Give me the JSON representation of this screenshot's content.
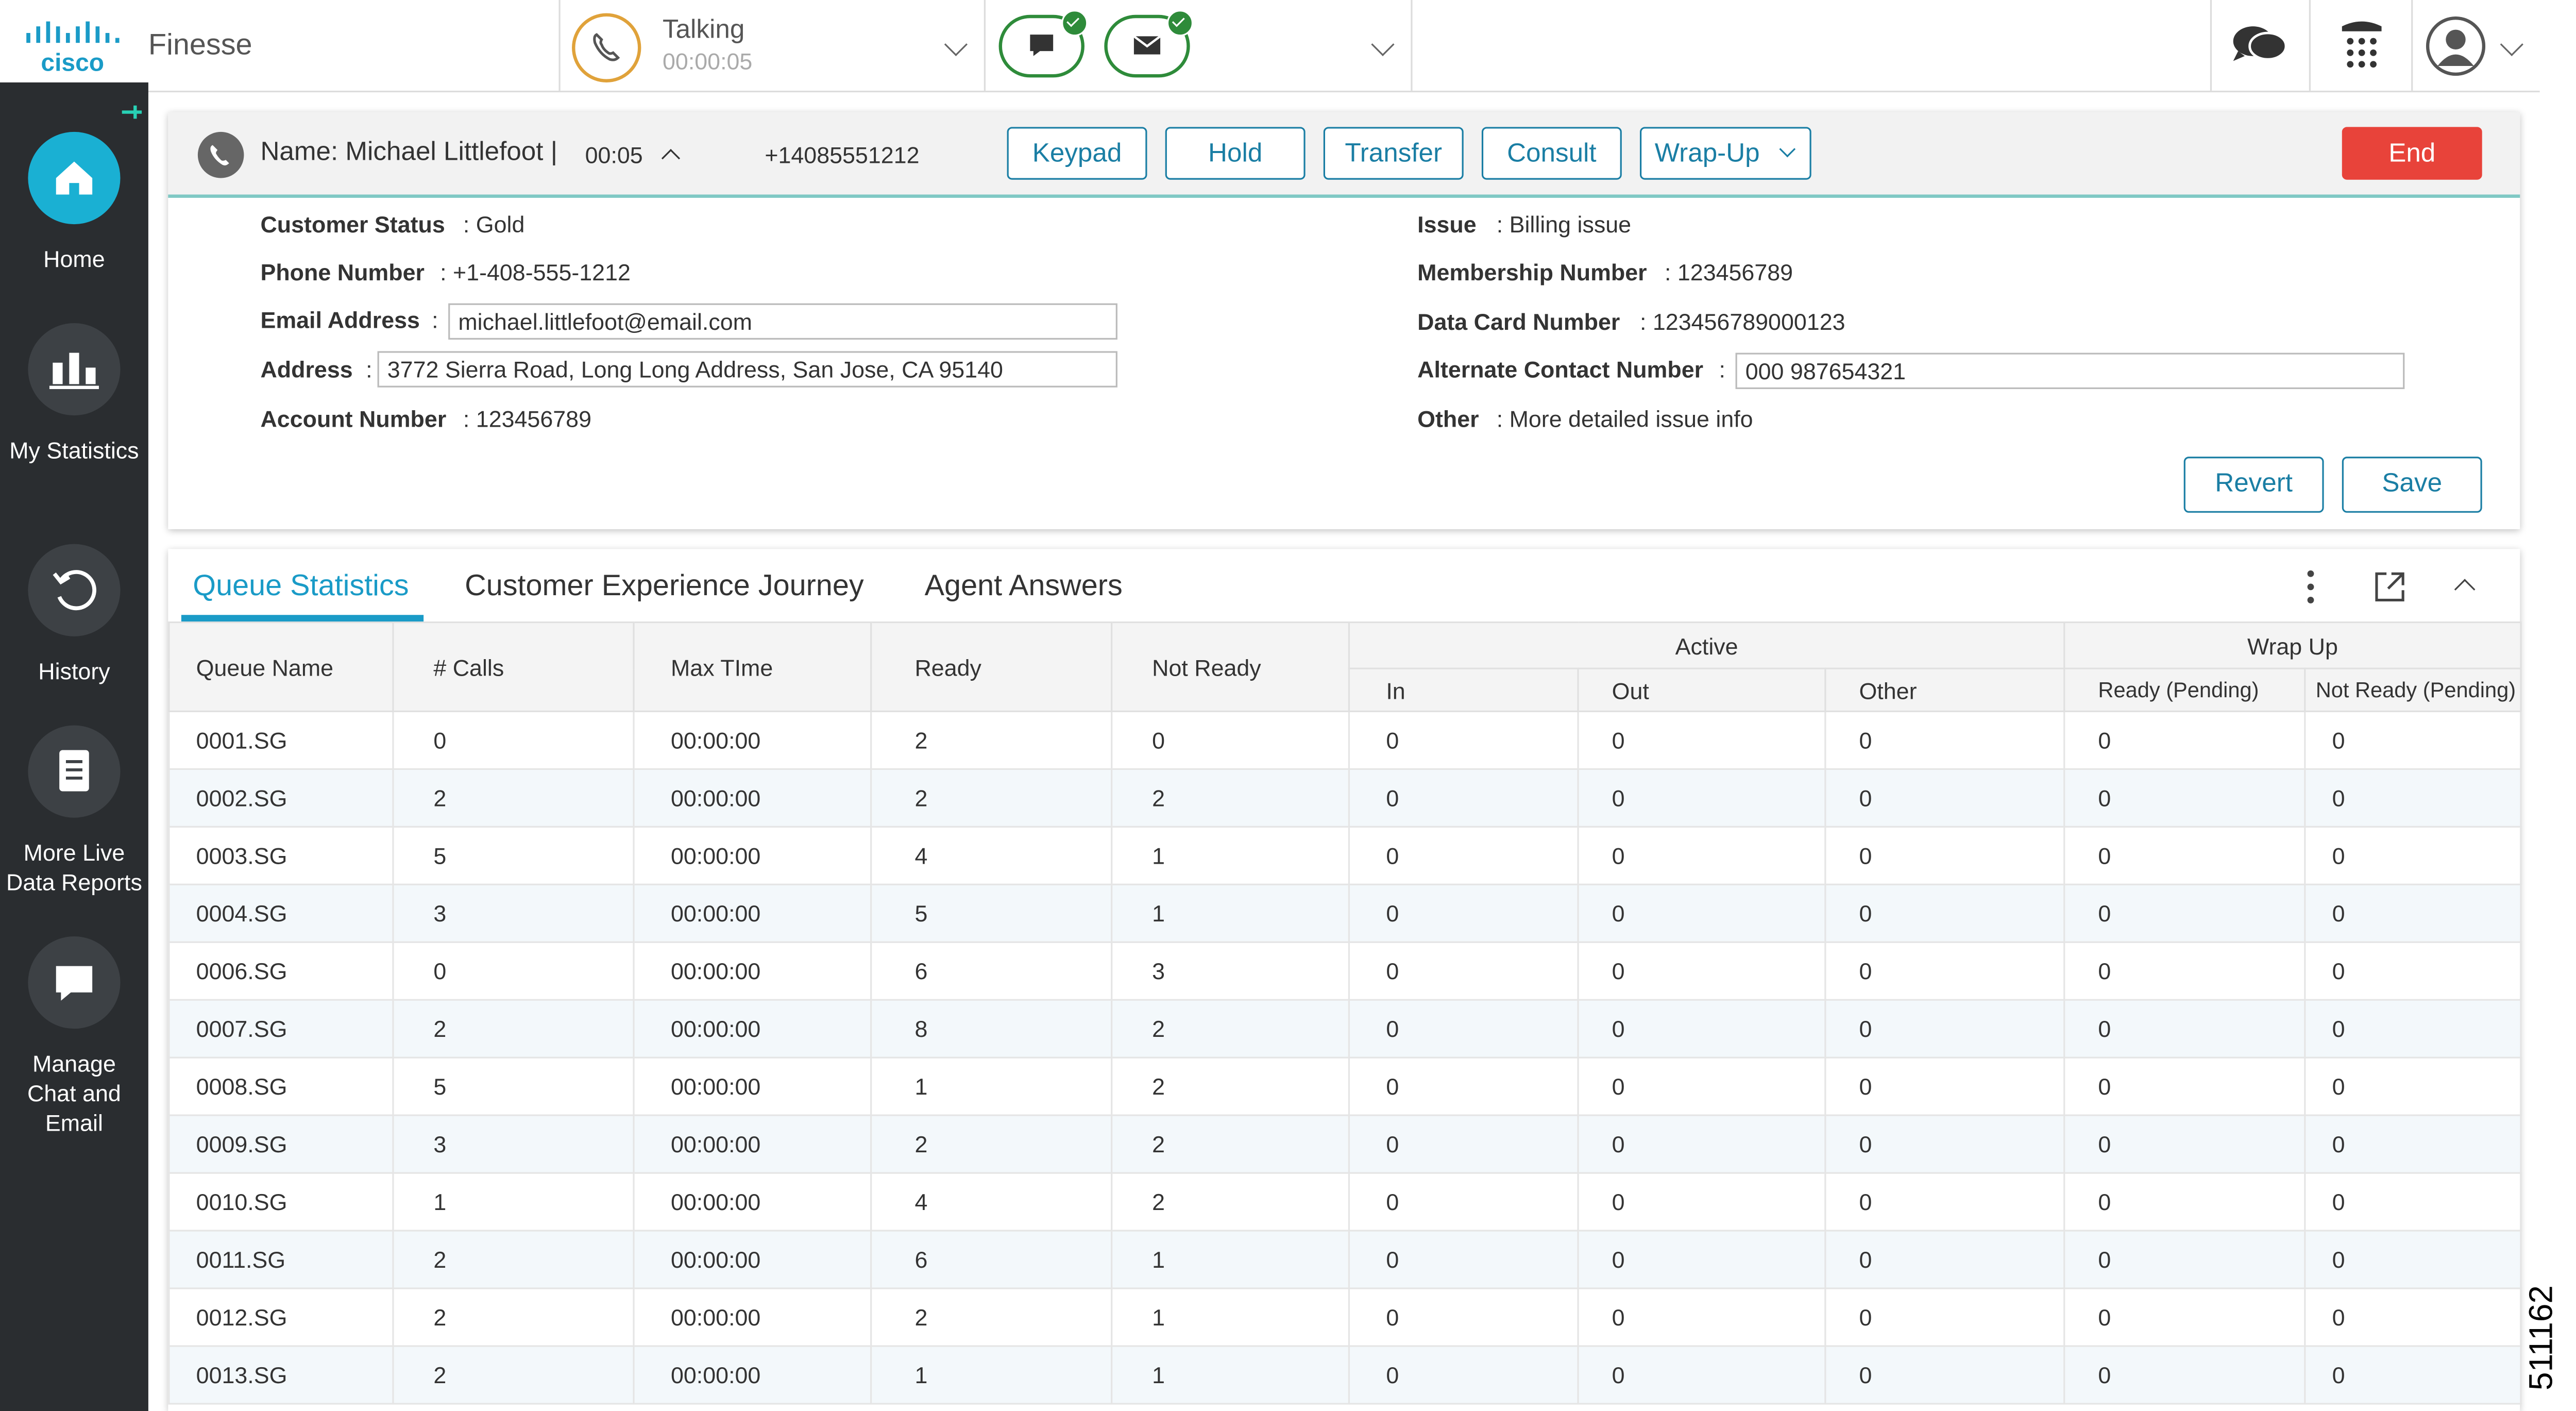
{
  "header": {
    "logo_text": "cisco",
    "app_name": "Finesse",
    "call_state": "Talking",
    "call_timer": "00:00:05"
  },
  "sidebar": {
    "items": [
      {
        "label": "Home",
        "icon": "home-icon",
        "active": true
      },
      {
        "label": "My Statistics",
        "icon": "statistics-icon"
      },
      {
        "label": "History",
        "icon": "history-icon"
      },
      {
        "label": "More Live Data Reports",
        "icon": "reports-icon"
      },
      {
        "label": "Manage Chat and Email",
        "icon": "chat-icon"
      }
    ]
  },
  "call": {
    "name": "Name: Michael Littlefoot |",
    "duration": "00:05",
    "number": "+14085551212",
    "buttons": {
      "keypad": "Keypad",
      "hold": "Hold",
      "transfer": "Transfer",
      "consult": "Consult",
      "wrapup": "Wrap-Up",
      "end": "End"
    }
  },
  "customer": {
    "left": [
      {
        "label": "Customer Status",
        "value": ": Gold"
      },
      {
        "label": "Phone Number",
        "value": ": +1-408-555-1212"
      },
      {
        "label": "Email Address",
        "value": "michael.littlefoot@email.com"
      },
      {
        "label": "Address",
        "value": "3772 Sierra Road, Long Long Address, San Jose, CA 95140"
      },
      {
        "label": "Account Number",
        "value": ": 123456789"
      }
    ],
    "right": [
      {
        "label": "Issue",
        "value": ": Billing issue"
      },
      {
        "label": "Membership Number",
        "value": ": 123456789"
      },
      {
        "label": "Data Card Number",
        "value": ": 123456789000123"
      },
      {
        "label": "Alternate Contact Number",
        "value": "000 987654321"
      },
      {
        "label": "Other",
        "value": ": More detailed issue info"
      }
    ],
    "colon": ":",
    "revert": "Revert",
    "save": "Save"
  },
  "queue": {
    "tabs": [
      "Queue Statistics",
      "Customer Experience Journey",
      "Agent Answers"
    ],
    "headers": {
      "queue_name": "Queue Name",
      "calls": "# Calls",
      "max_time": "Max TIme",
      "ready": "Ready",
      "not_ready": "Not Ready",
      "active": "Active",
      "in": "In",
      "out": "Out",
      "other": "Other",
      "wrap_up": "Wrap Up",
      "ready_pending": "Ready (Pending)",
      "not_ready_pending": "Not Ready (Pending)"
    },
    "rows": [
      [
        "0001.SG",
        "0",
        "00:00:00",
        "2",
        "0",
        "0",
        "0",
        "0",
        "0",
        "0"
      ],
      [
        "0002.SG",
        "2",
        "00:00:00",
        "2",
        "2",
        "0",
        "0",
        "0",
        "0",
        "0"
      ],
      [
        "0003.SG",
        "5",
        "00:00:00",
        "4",
        "1",
        "0",
        "0",
        "0",
        "0",
        "0"
      ],
      [
        "0004.SG",
        "3",
        "00:00:00",
        "5",
        "1",
        "0",
        "0",
        "0",
        "0",
        "0"
      ],
      [
        "0006.SG",
        "0",
        "00:00:00",
        "6",
        "3",
        "0",
        "0",
        "0",
        "0",
        "0"
      ],
      [
        "0007.SG",
        "2",
        "00:00:00",
        "8",
        "2",
        "0",
        "0",
        "0",
        "0",
        "0"
      ],
      [
        "0008.SG",
        "5",
        "00:00:00",
        "1",
        "2",
        "0",
        "0",
        "0",
        "0",
        "0"
      ],
      [
        "0009.SG",
        "3",
        "00:00:00",
        "2",
        "2",
        "0",
        "0",
        "0",
        "0",
        "0"
      ],
      [
        "0010.SG",
        "1",
        "00:00:00",
        "4",
        "2",
        "0",
        "0",
        "0",
        "0",
        "0"
      ],
      [
        "0011.SG",
        "2",
        "00:00:00",
        "6",
        "1",
        "0",
        "0",
        "0",
        "0",
        "0"
      ],
      [
        "0012.SG",
        "2",
        "00:00:00",
        "2",
        "1",
        "0",
        "0",
        "0",
        "0",
        "0"
      ],
      [
        "0013.SG",
        "2",
        "00:00:00",
        "1",
        "1",
        "0",
        "0",
        "0",
        "0",
        "0"
      ]
    ]
  },
  "figure_id": "511162"
}
